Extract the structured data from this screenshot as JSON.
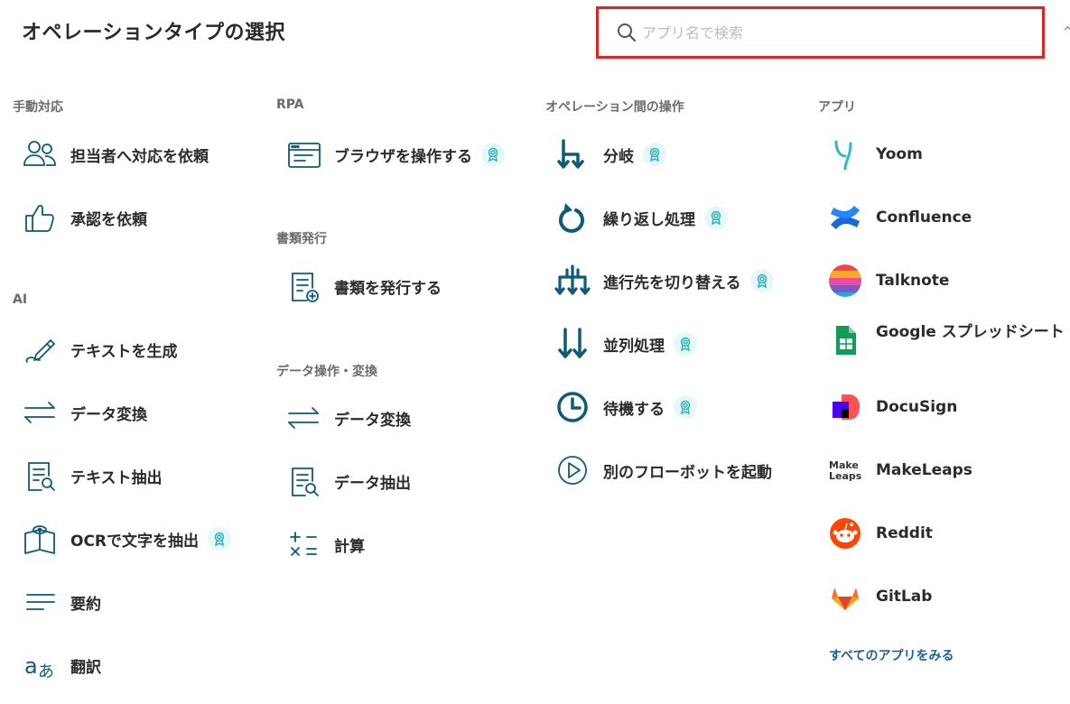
{
  "header": {
    "title": "オペレーションタイプの選択",
    "search_placeholder": "アプリ名で検索"
  },
  "categories": {
    "manual": {
      "label": "手動対応",
      "items": [
        {
          "label": "担当者へ対応を依頼",
          "icon": "people-icon"
        },
        {
          "label": "承認を依頼",
          "icon": "thumbs-up-icon"
        }
      ]
    },
    "ai": {
      "label": "AI",
      "items": [
        {
          "label": "テキストを生成",
          "icon": "pen-icon"
        },
        {
          "label": "データ変換",
          "icon": "swap-arrows-icon"
        },
        {
          "label": "テキスト抽出",
          "icon": "document-search-icon"
        },
        {
          "label": "OCRで文字を抽出",
          "icon": "book-eye-icon",
          "badge": true
        },
        {
          "label": "要約",
          "icon": "lines-icon"
        },
        {
          "label": "翻訳",
          "icon": "translate-icon"
        }
      ]
    },
    "rpa": {
      "label": "RPA",
      "items": [
        {
          "label": "ブラウザを操作する",
          "icon": "browser-icon",
          "badge": true
        }
      ]
    },
    "documents": {
      "label": "書類発行",
      "items": [
        {
          "label": "書類を発行する",
          "icon": "document-plus-icon"
        }
      ]
    },
    "data_ops": {
      "label": "データ操作・変換",
      "items": [
        {
          "label": "データ変換",
          "icon": "swap-arrows-icon"
        },
        {
          "label": "データ抽出",
          "icon": "document-search-icon"
        },
        {
          "label": "計算",
          "icon": "calculator-icon"
        }
      ]
    },
    "flow_ops": {
      "label": "オペレーション間の操作",
      "items": [
        {
          "label": "分岐",
          "icon": "branch-icon",
          "badge": true
        },
        {
          "label": "繰り返し処理",
          "icon": "loop-icon",
          "badge": true
        },
        {
          "label": "進行先を切り替える",
          "icon": "switch-route-icon",
          "badge": true
        },
        {
          "label": "並列処理",
          "icon": "parallel-icon",
          "badge": true
        },
        {
          "label": "待機する",
          "icon": "clock-icon",
          "badge": true
        },
        {
          "label": "別のフローボットを起動",
          "icon": "play-icon"
        }
      ]
    },
    "apps": {
      "label": "アプリ",
      "items": [
        {
          "label": "Yoom",
          "icon": "yoom-logo-icon"
        },
        {
          "label": "Confluence",
          "icon": "confluence-logo-icon"
        },
        {
          "label": "Talknote",
          "icon": "talknote-logo-icon"
        },
        {
          "label": "Google スプレッドシート",
          "icon": "google-sheets-logo-icon"
        },
        {
          "label": "DocuSign",
          "icon": "docusign-logo-icon"
        },
        {
          "label": "MakeLeaps",
          "icon": "makeleaps-logo-icon",
          "logo_text": "Make Leaps"
        },
        {
          "label": "Reddit",
          "icon": "reddit-logo-icon"
        },
        {
          "label": "GitLab",
          "icon": "gitlab-logo-icon"
        }
      ],
      "view_all": "すべてのアプリをみる"
    }
  },
  "colors": {
    "icon_primary": "#0f5a74",
    "badge_bg": "#e6f7f8",
    "badge_icon": "#2bb3b3",
    "search_border": "#e02424",
    "link": "#1d5f9e"
  }
}
